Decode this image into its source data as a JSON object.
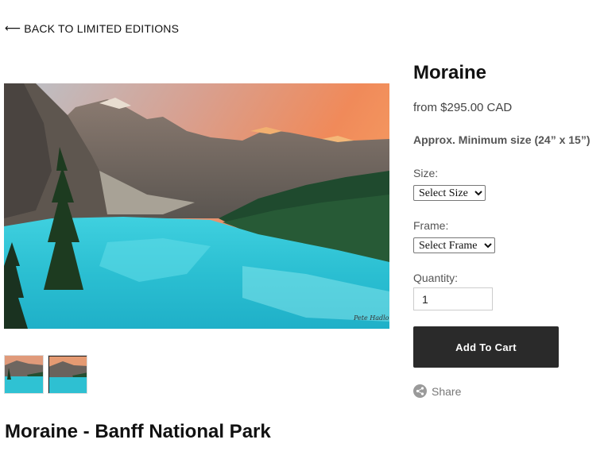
{
  "nav": {
    "back_arrow": "⟵",
    "back_label": "BACK TO LIMITED EDITIONS"
  },
  "product": {
    "title": "Moraine",
    "price": "from $295.00 CAD",
    "min_size": "Approx. Minimum size (24” x 15”)",
    "size_label": "Size:",
    "size_selected": "Select Size",
    "frame_label": "Frame:",
    "frame_selected": "Select Frame",
    "quantity_label": "Quantity:",
    "quantity_value": "1",
    "add_to_cart": "Add To Cart",
    "share_label": "Share"
  },
  "gallery": {
    "main_image": "mountain-lake-photo",
    "thumbnails": [
      "mountain-lake-thumb",
      "mountain-lake-thumb"
    ]
  },
  "description": {
    "heading": "Moraine - Banff National Park"
  },
  "colors": {
    "button_bg": "#2a2a2a",
    "button_text": "#ffffff",
    "lake": "#2cc3d4"
  },
  "icons": {
    "share": "share-icon"
  }
}
